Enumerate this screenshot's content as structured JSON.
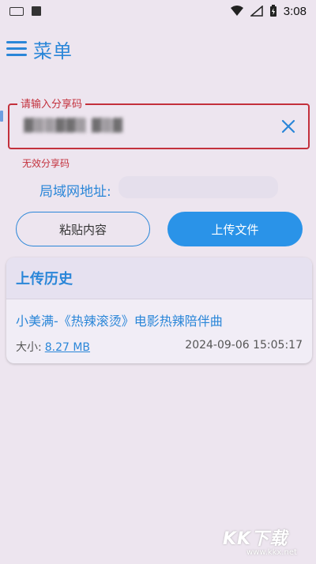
{
  "status_bar": {
    "time": "3:08"
  },
  "header": {
    "title": "菜单"
  },
  "share_code": {
    "label": "请输入分享码",
    "value": "▓▒▒▓▓▒ ▓▒▓",
    "error": "无效分享码"
  },
  "lan": {
    "label": "局域网地址:",
    "value": ""
  },
  "buttons": {
    "paste": "粘贴内容",
    "upload": "上传文件"
  },
  "history": {
    "title": "上传历史",
    "items": [
      {
        "file_name": "小美满-《热辣滚烫》电影热辣陪伴曲",
        "size_label": "大小:",
        "size": "8.27 MB",
        "time": "2024-09-06 15:05:17"
      }
    ]
  },
  "watermark": {
    "text": "KK下载",
    "url": "www.kkx.net"
  },
  "colors": {
    "accent": "#2a86d8",
    "error": "#c3303c",
    "background": "#ede5ef",
    "primary_button": "#2a93e8"
  }
}
